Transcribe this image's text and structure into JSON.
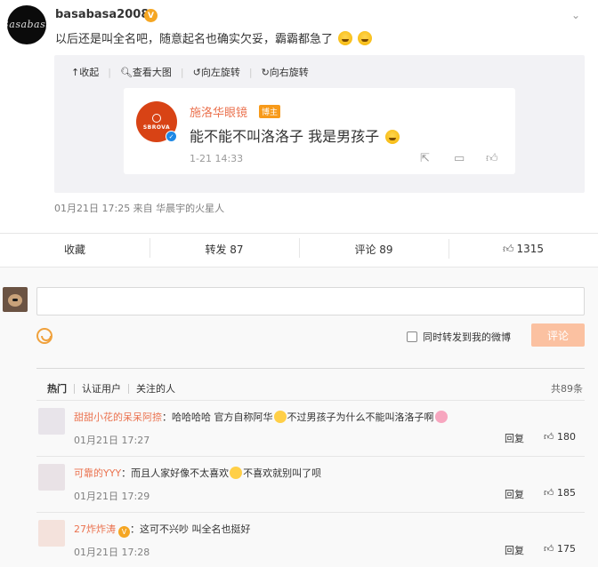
{
  "post": {
    "author": "basabasa2008",
    "avatar_sig": "Basabasa",
    "verified_icon": "v-badge-icon",
    "text": "以后还是叫全名吧，随意起名也确实欠妥，霸霸都急了",
    "media_tools": {
      "collapse": "收起",
      "view_large": "查看大图",
      "rotate_left": "向左旋转",
      "rotate_right": "向右旋转"
    },
    "quoted": {
      "author": "施洛华眼镜",
      "tag": "博主",
      "logo_text": "SBROVA",
      "text": "能不能不叫洛洛子 我是男孩子",
      "time": "1-21 14:33"
    },
    "meta": "01月21日 17:25  来自 华晨宇的火星人"
  },
  "actions": {
    "favorite": "收藏",
    "repost": "转发 87",
    "comment": "评论 89",
    "like": "1315"
  },
  "composer": {
    "placeholder": "",
    "forward_label": "同时转发到我的微博",
    "submit": "评论"
  },
  "comment_tabs": {
    "hot": "热门",
    "verified": "认证用户",
    "following": "关注的人",
    "total": "共89条"
  },
  "comments": [
    {
      "user": "甜甜小花的呆呆阿捺",
      "text_before": "：哈哈哈哈 官方自称阿华",
      "text_after": "不过男孩子为什么不能叫洛洛子啊",
      "time": "01月21日 17:27",
      "reply": "回复",
      "likes": "180"
    },
    {
      "user": "可靠的YYY",
      "text_before": "：而且人家好像不太喜欢",
      "text_after": "不喜欢就别叫了呗",
      "time": "01月21日 17:29",
      "reply": "回复",
      "likes": "185"
    },
    {
      "user": "27炸炸涛",
      "text_before": "：这可不兴吵 叫全名也挺好",
      "text_after": "",
      "time": "01月21日 17:28",
      "reply": "回复",
      "likes": "175"
    }
  ],
  "colors": {
    "link_orange": "#eb7350",
    "submit_disabled": "#fbc1a1",
    "badge_gold": "#f5a623"
  }
}
